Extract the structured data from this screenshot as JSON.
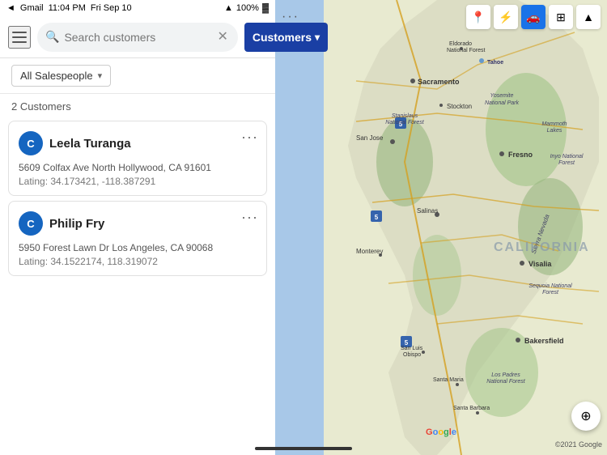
{
  "statusBar": {
    "app": "Gmail",
    "time": "11:04 PM",
    "day": "Fri Sep 10",
    "battery": "100%",
    "batteryIcon": "🔋"
  },
  "topBar": {
    "searchPlaceholder": "Search customers",
    "searchValue": "Search customers",
    "customersLabel": "Customers",
    "chevron": "▾",
    "hamburgerAria": "Menu"
  },
  "filterBar": {
    "salespersonLabel": "All Salespeople",
    "arrowIcon": "▾"
  },
  "customerList": {
    "countLabel": "2 Customers",
    "customers": [
      {
        "avatarInitial": "C",
        "name": "Leela Turanga",
        "address": "5609 Colfax Ave North Hollywood, CA 91601",
        "lating": "Lating: 34.173421, -118.387291"
      },
      {
        "avatarInitial": "C",
        "name": "Philip Fry",
        "address": "5950 Forest Lawn Dr Los Angeles, CA 90068",
        "lating": "Lating: 34.1522174, 118.319072"
      }
    ]
  },
  "map": {
    "dotsLabel": "···",
    "locationIcon": "◎",
    "googleLogo": "Google",
    "copyright": "©2021 Google",
    "mapIcons": [
      {
        "name": "location-pin-icon",
        "symbol": "📍",
        "active": false
      },
      {
        "name": "bluetooth-icon",
        "symbol": "⚡",
        "active": false
      },
      {
        "name": "car-icon",
        "symbol": "🚗",
        "active": true
      },
      {
        "name": "layers-icon",
        "symbol": "◧",
        "active": false
      },
      {
        "name": "mountain-icon",
        "symbol": "▲",
        "active": false
      }
    ]
  }
}
